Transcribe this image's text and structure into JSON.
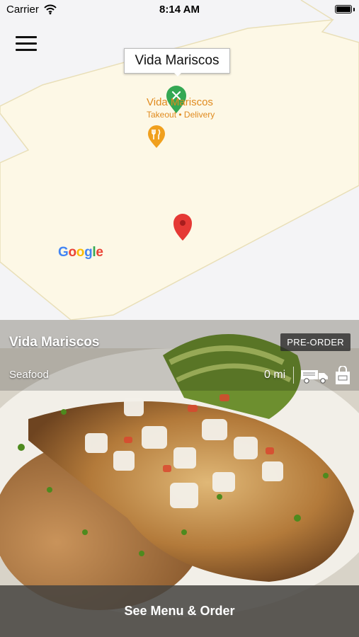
{
  "status_bar": {
    "carrier": "Carrier",
    "time": "8:14 AM"
  },
  "map": {
    "callout_title": "Vida Mariscos",
    "place_name": "Vida Mariscos",
    "place_services": "Takeout • Delivery",
    "logo_text": [
      "G",
      "o",
      "o",
      "g",
      "l",
      "e"
    ],
    "logo_colors": [
      "#4285F4",
      "#EA4335",
      "#FBBC05",
      "#4285F4",
      "#34A853",
      "#EA4335"
    ]
  },
  "restaurant": {
    "name": "Vida Mariscos",
    "badge": "PRE-ORDER",
    "category": "Seafood",
    "distance": "0 mi",
    "cta_label": "See Menu & Order"
  },
  "colors": {
    "pin_red": "#e53935",
    "pin_green": "#34a853",
    "place_orange": "#e08a1e",
    "map_zone": "#fdf8e6"
  }
}
